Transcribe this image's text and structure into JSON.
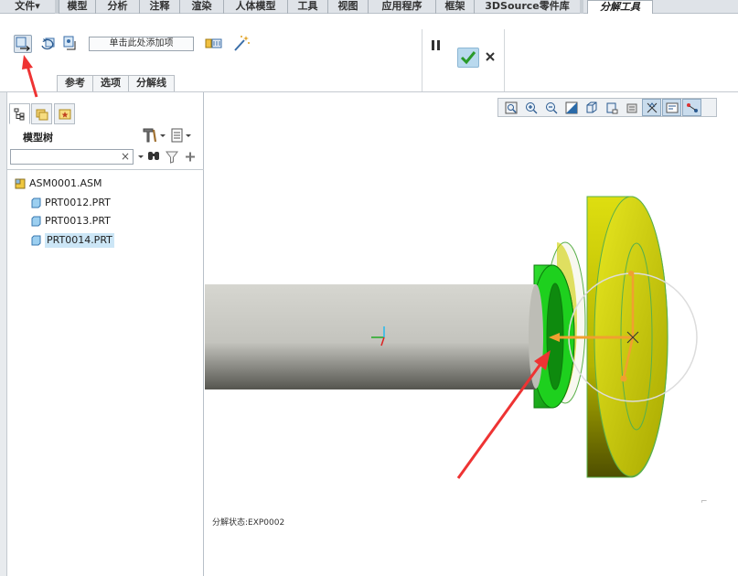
{
  "menu_tabs": [
    {
      "label": "文件▾"
    },
    {
      "label": "模型"
    },
    {
      "label": "分析"
    },
    {
      "label": "注释"
    },
    {
      "label": "渲染"
    },
    {
      "label": "人体模型"
    },
    {
      "label": "工具"
    },
    {
      "label": "视图"
    },
    {
      "label": "应用程序"
    },
    {
      "label": "框架"
    },
    {
      "label": "3DSource零件库"
    },
    {
      "label": "分解工具"
    }
  ],
  "ribbon": {
    "collector_text": "单击此处添加项",
    "subtabs": [
      "参考",
      "选项",
      "分解线"
    ]
  },
  "model_tree": {
    "title": "模型树",
    "search_placeholder": "",
    "search_clear": "×",
    "items": [
      {
        "label": "ASM0001.ASM"
      },
      {
        "label": "PRT0012.PRT"
      },
      {
        "label": "PRT0013.PRT"
      },
      {
        "label": "PRT0014.PRT"
      }
    ]
  },
  "graphics": {
    "status_text": "分解状态:EXP0002"
  },
  "colors": {
    "shaft": "#c8c8c2",
    "green_part": "#22cc22",
    "yellow_part": "#c8c800",
    "accent_arrow": "#ee3333",
    "drag_handle": "#f0a030",
    "selection": "#cce6f6"
  }
}
